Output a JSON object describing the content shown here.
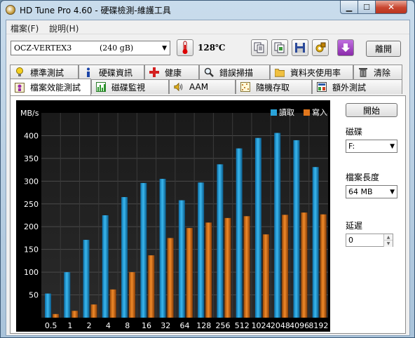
{
  "window": {
    "title": "HD Tune Pro 4.60 - 硬碟檢測-維護工具",
    "min_glyph": "▁",
    "max_glyph": "☐",
    "close_glyph": "✕"
  },
  "menu": [
    {
      "label": "檔案(F)"
    },
    {
      "label": "說明(H)"
    }
  ],
  "toolbar": {
    "drive_name": "OCZ-VERTEX3",
    "drive_size": "(240 gB)",
    "temperature": "128℃",
    "exit_label": "離開",
    "icons": [
      "copy-text-icon",
      "copy-screenshot-icon",
      "save-icon",
      "options-icon",
      "download-icon"
    ]
  },
  "tabs_row1": [
    {
      "label": "標準測試",
      "icon": "bulb-icon"
    },
    {
      "label": "硬碟資訊",
      "icon": "info-icon"
    },
    {
      "label": "健康",
      "icon": "health-cross-icon"
    },
    {
      "label": "錯誤掃描",
      "icon": "magnifier-icon"
    },
    {
      "label": "資料夾使用率",
      "icon": "folder-icon"
    },
    {
      "label": "清除",
      "icon": "trash-icon"
    }
  ],
  "tabs_row2": [
    {
      "label": "檔案效能測試",
      "icon": "file-benchmark-icon",
      "active": true
    },
    {
      "label": "磁碟監視",
      "icon": "disk-monitor-icon"
    },
    {
      "label": "AAM",
      "icon": "speaker-icon"
    },
    {
      "label": "隨機存取",
      "icon": "random-access-icon"
    },
    {
      "label": "額外測試",
      "icon": "extra-tests-icon"
    }
  ],
  "side": {
    "start_label": "開始",
    "drive_label": "磁碟",
    "drive_value": "F:",
    "file_length_label": "檔案長度",
    "file_length_value": "64 MB",
    "delay_label": "延遲",
    "delay_value": "0"
  },
  "chart_data": {
    "type": "bar",
    "ylabel": "MB/s",
    "xlabel": "",
    "ylim": [
      0,
      450
    ],
    "yticks": [
      50,
      100,
      150,
      200,
      250,
      300,
      350,
      400
    ],
    "categories": [
      "0.5",
      "1",
      "2",
      "4",
      "8",
      "16",
      "32",
      "64",
      "128",
      "256",
      "512",
      "1024",
      "2048",
      "4096",
      "8192"
    ],
    "legend_position": "top-right",
    "grid": true,
    "series": [
      {
        "name": "讀取",
        "color": "#29a3d9",
        "values": [
          53,
          100,
          171,
          225,
          265,
          296,
          305,
          258,
          297,
          337,
          372,
          395,
          406,
          390,
          331
        ]
      },
      {
        "name": "寫入",
        "color": "#e0761c",
        "values": [
          8,
          15,
          29,
          62,
          100,
          137,
          175,
          197,
          209,
          219,
          223,
          183,
          226,
          231,
          227
        ]
      }
    ]
  }
}
